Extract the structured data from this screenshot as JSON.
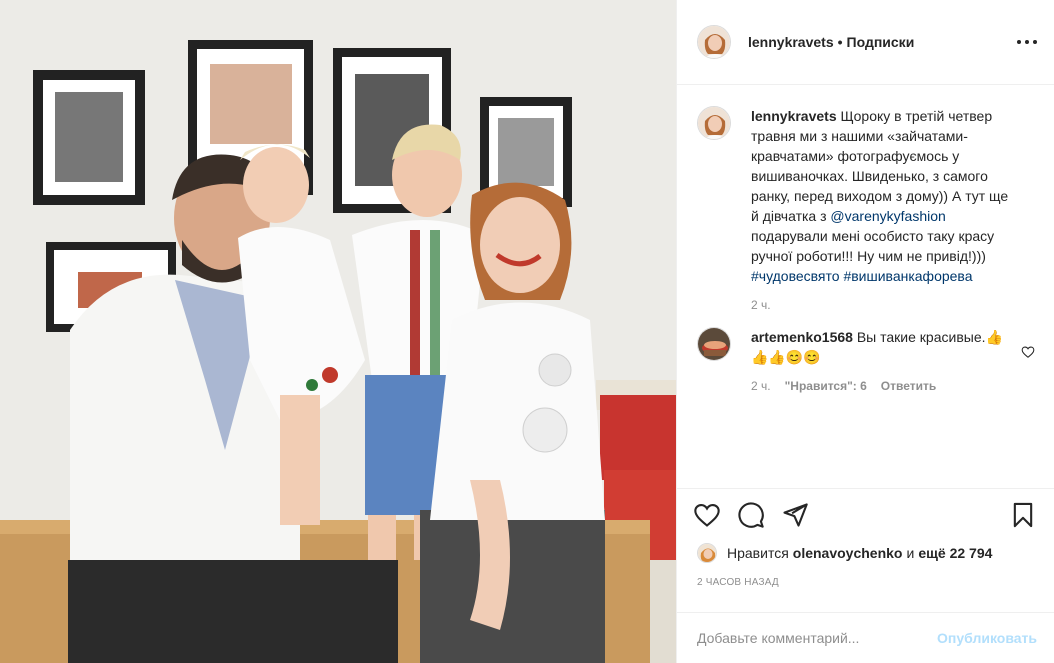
{
  "post": {
    "author": "lennykravets",
    "separator": "•",
    "follow_label": "Подписки",
    "caption_user": "lennykravets",
    "caption_text": "Щороку в третій четвер травня ми з нашими «зайчатами- кравчатами» фотографуємось у вишиваночках. Швиденько, з самого ранку, перед виходом з дому)) А тут ще й дівчатка з ",
    "caption_mention": "@varenykyfashion",
    "caption_text_2": " подарували мені особисто таку красу ручної роботи!!! Ну чим не привід!)))",
    "hashtag_1": "#чудовесвято",
    "hashtag_2": "#вишиванкафорева",
    "caption_time": "2 ч."
  },
  "comment": {
    "user": "artemenko1568",
    "text": "Вы такие красивые.👍👍👍😊😊",
    "time": "2 ч.",
    "likes_label": "\"Нравится\": 6",
    "reply_label": "Ответить"
  },
  "actions": {
    "liked_prefix": "Нравится",
    "liked_user": "olenavoychenko",
    "liked_suffix_1": "и",
    "liked_count": "ещё 22 794",
    "timestamp": "2 ЧАСОВ НАЗАД"
  },
  "add_comment": {
    "placeholder": "Добавьте комментарий...",
    "publish_label": "Опубликовать"
  },
  "colors": {
    "text": "#262626",
    "muted": "#8e8e8e",
    "link": "#00376b",
    "publish_disabled": "#b2dffc"
  }
}
